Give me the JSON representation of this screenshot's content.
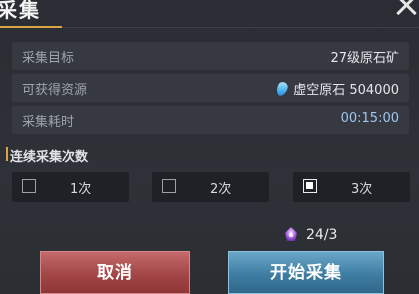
{
  "header": {
    "title": "采集"
  },
  "info": {
    "target_label": "采集目标",
    "target_value": "27级原石矿",
    "resource_label": "可获得资源",
    "resource_value": "虚空原石 504000",
    "resource_icon": "blue-crystal-icon",
    "time_label": "采集耗时",
    "time_value": "00:15:00"
  },
  "count": {
    "title": "连续采集次数",
    "options": [
      {
        "label": "1次",
        "checked": false
      },
      {
        "label": "2次",
        "checked": false
      },
      {
        "label": "3次",
        "checked": true
      }
    ]
  },
  "cost": {
    "icon": "purple-energy-icon",
    "text": "24/3"
  },
  "buttons": {
    "cancel": "取消",
    "start": "开始采集"
  },
  "colors": {
    "accent": "#d9a441",
    "cancel": "#a24647",
    "start": "#3f7da3",
    "time": "#9ec7f0"
  }
}
